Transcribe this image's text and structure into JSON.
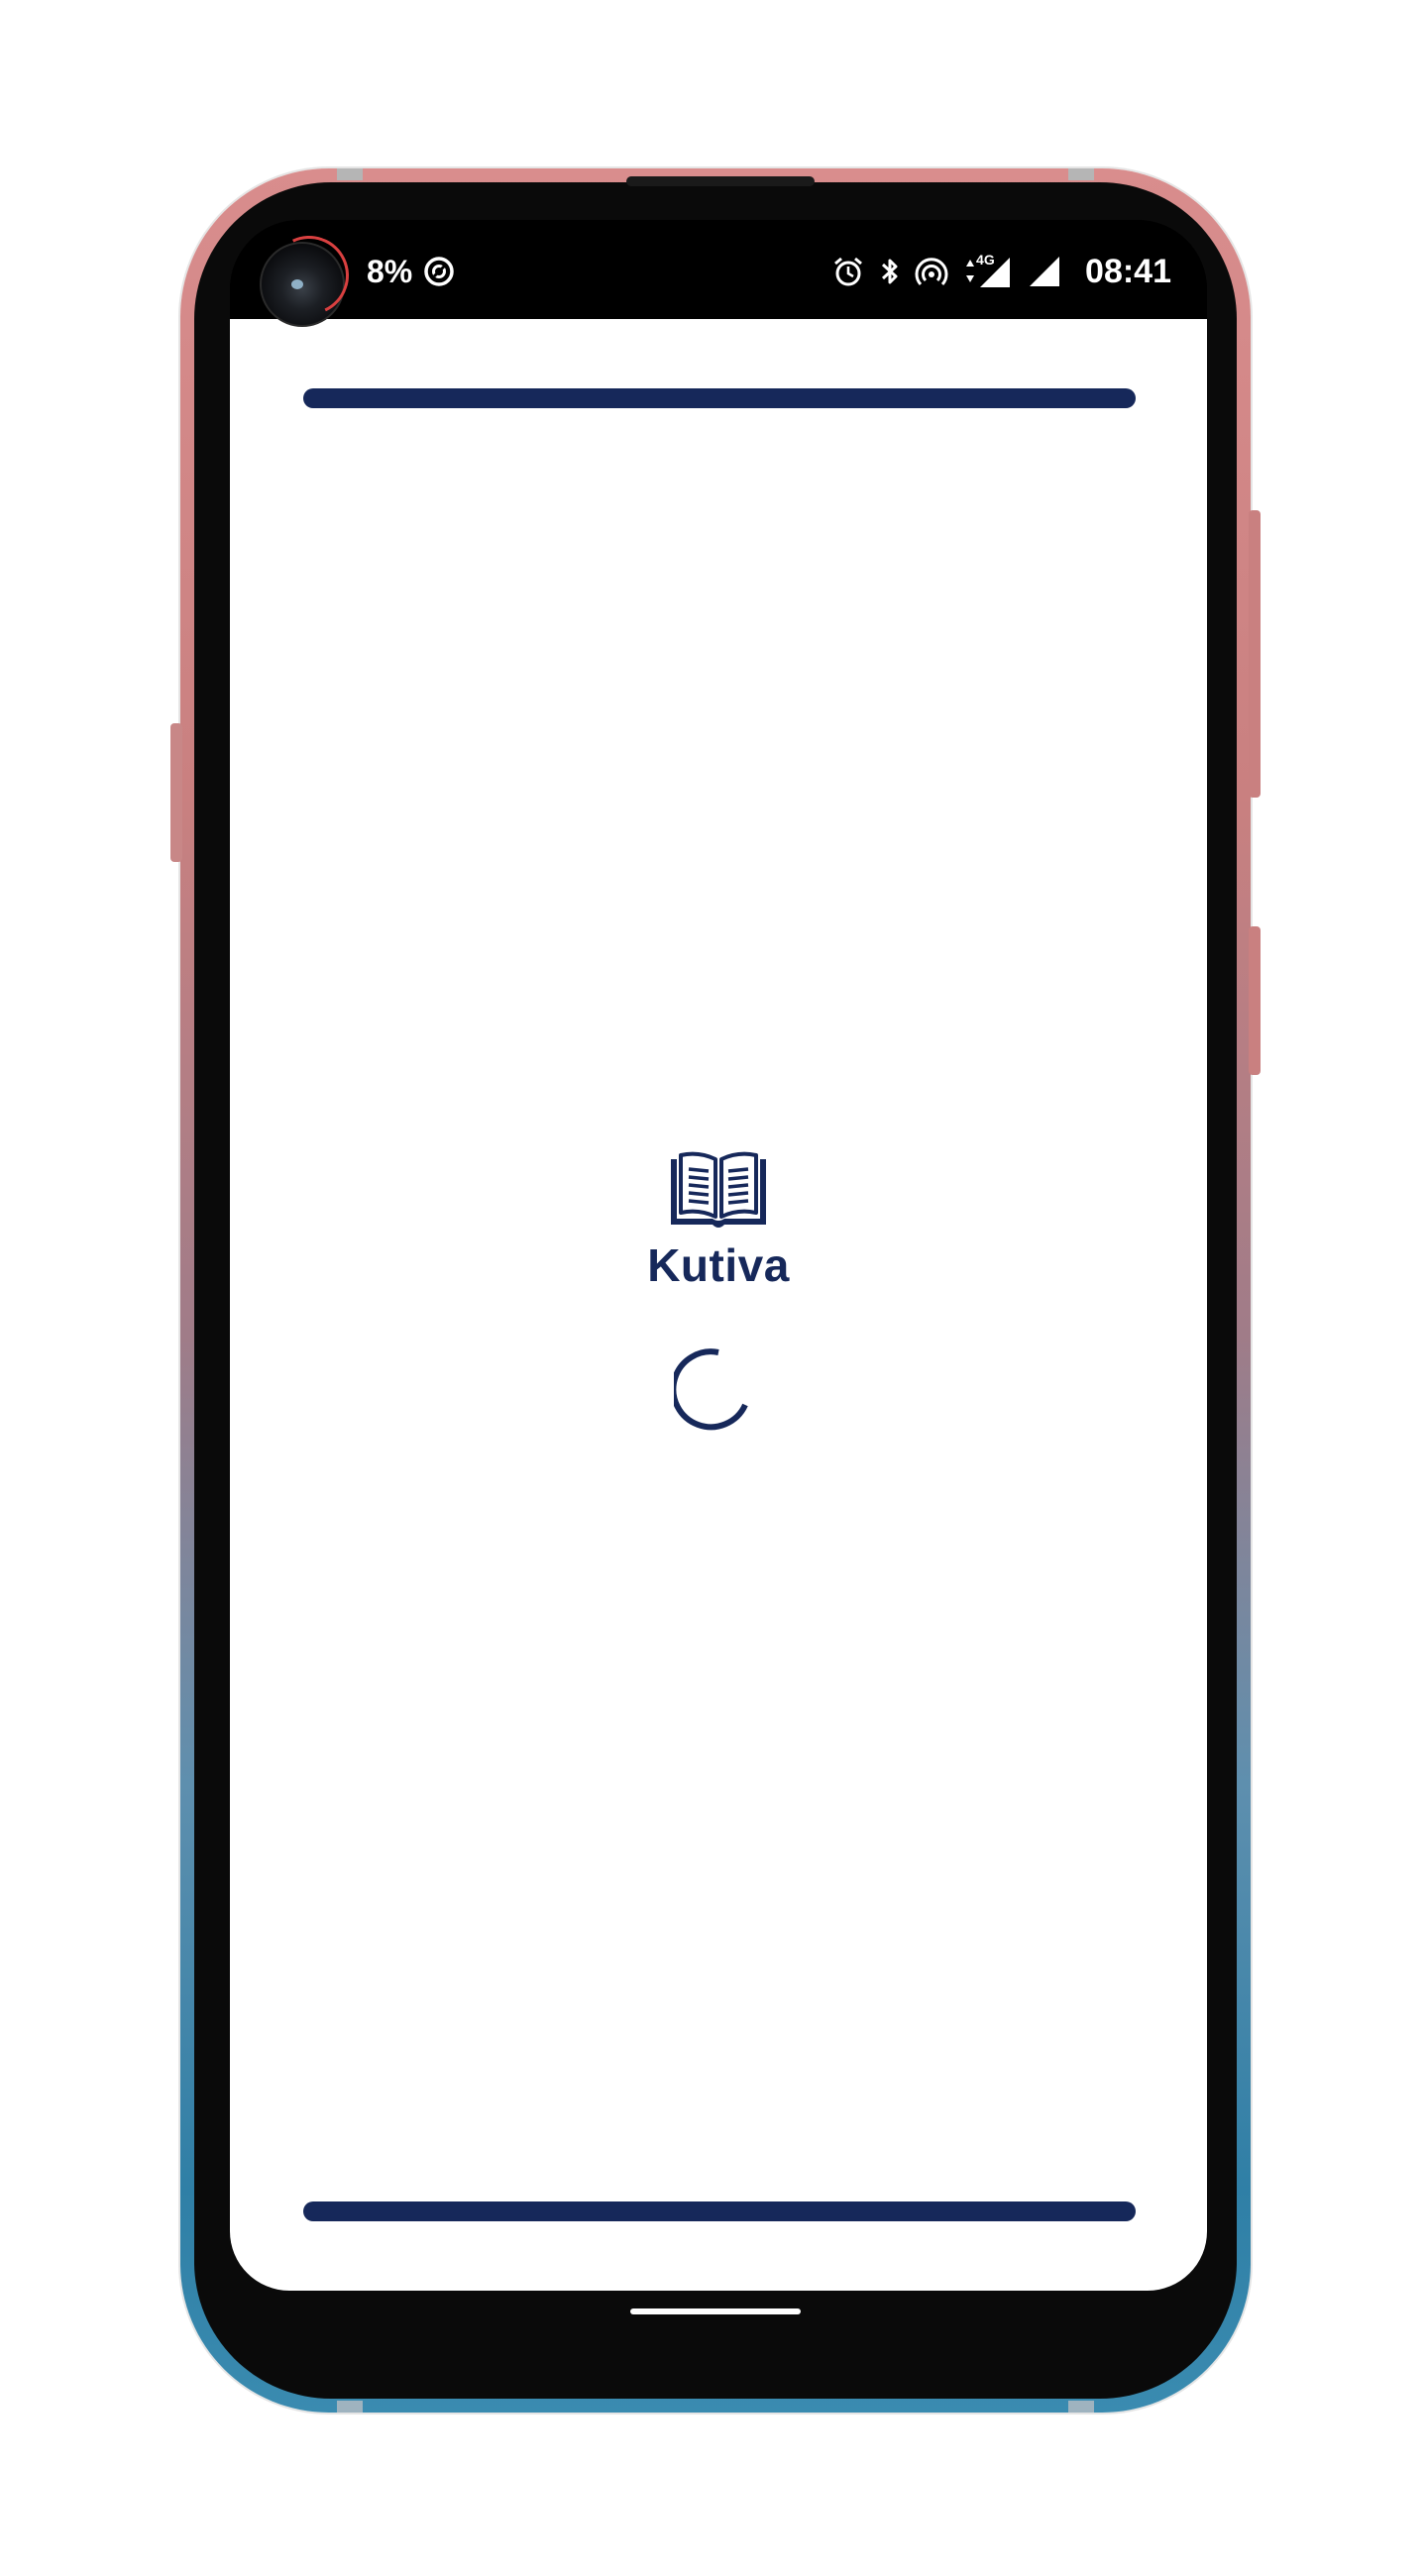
{
  "status_bar": {
    "battery_percent": "8%",
    "time": "08:41",
    "network_label": "4G",
    "icons": [
      "data-saver-icon",
      "alarm-icon",
      "bluetooth-icon",
      "hotspot-icon",
      "mobile-data-icon",
      "signal-icon"
    ]
  },
  "app": {
    "brand_name": "Kutiva",
    "logo_icon": "open-book-icon",
    "loading_indicator": "spinner"
  },
  "colors": {
    "brand_navy": "#16285a",
    "frame_top": "#d98d8d",
    "frame_bottom": "#3a8bb0"
  }
}
